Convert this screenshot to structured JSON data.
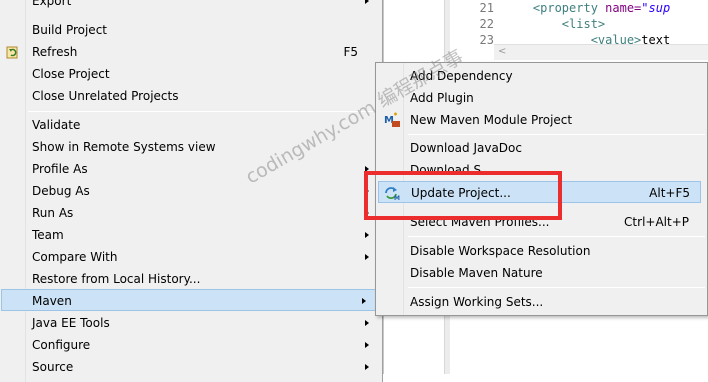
{
  "editor": {
    "lines": [
      {
        "num": "21",
        "indent": "    ",
        "open": "<property ",
        "attr": "name=",
        "val": "\"sup"
      },
      {
        "num": "22",
        "indent": "        ",
        "open": "<list>",
        "attr": "",
        "val": ""
      },
      {
        "num": "23",
        "indent": "            ",
        "open": "<value>",
        "attr": "",
        "val": "text"
      }
    ],
    "scroll_left": "<"
  },
  "left_menu": {
    "items": [
      {
        "label": "Export",
        "accel": "",
        "arrow": true
      },
      {
        "label": "Build Project",
        "accel": "",
        "arrow": false
      },
      {
        "label": "Refresh",
        "accel": "F5",
        "arrow": false
      },
      {
        "label": "Close Project",
        "accel": "",
        "arrow": false
      },
      {
        "label": "Close Unrelated Projects",
        "accel": "",
        "arrow": false
      },
      {
        "label": "Validate",
        "accel": "",
        "arrow": false
      },
      {
        "label": "Show in Remote Systems view",
        "accel": "",
        "arrow": false
      },
      {
        "label": "Profile As",
        "accel": "",
        "arrow": true
      },
      {
        "label": "Debug As",
        "accel": "",
        "arrow": true
      },
      {
        "label": "Run As",
        "accel": "",
        "arrow": true
      },
      {
        "label": "Team",
        "accel": "",
        "arrow": true
      },
      {
        "label": "Compare With",
        "accel": "",
        "arrow": true
      },
      {
        "label": "Restore from Local History...",
        "accel": "",
        "arrow": false
      },
      {
        "label": "Maven",
        "accel": "",
        "arrow": true
      },
      {
        "label": "Java EE Tools",
        "accel": "",
        "arrow": true
      },
      {
        "label": "Configure",
        "accel": "",
        "arrow": true
      },
      {
        "label": "Source",
        "accel": "",
        "arrow": true
      }
    ]
  },
  "maven_submenu": {
    "items": [
      {
        "label": "Add Dependency",
        "accel": ""
      },
      {
        "label": "Add Plugin",
        "accel": ""
      },
      {
        "label": "New Maven Module Project",
        "accel": ""
      },
      {
        "label": "Download JavaDoc",
        "accel": ""
      },
      {
        "label": "Download S",
        "accel": ""
      },
      {
        "label": "Update Project...",
        "accel": "Alt+F5"
      },
      {
        "label": "Select Maven Profiles...",
        "accel": "Ctrl+Alt+P"
      },
      {
        "label": "Disable Workspace Resolution",
        "accel": ""
      },
      {
        "label": "Disable Maven Nature",
        "accel": ""
      },
      {
        "label": "Assign Working Sets...",
        "accel": ""
      }
    ]
  },
  "watermark": "codingwhy.com 编程那点事",
  "colors": {
    "menu_bg": "#f0f0f0",
    "highlight_bg": "#cce3f7",
    "highlight_border": "#9cc4e8",
    "annotation_red": "#ec2d2d"
  }
}
